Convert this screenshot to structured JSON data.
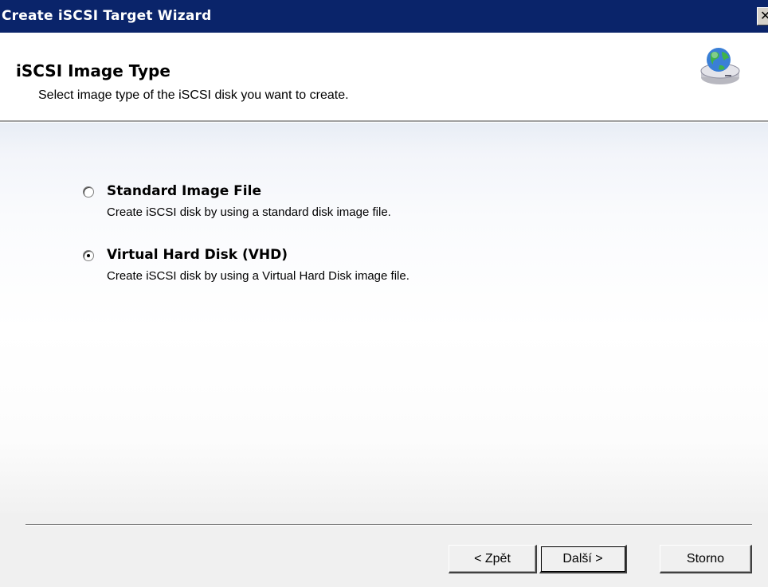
{
  "window": {
    "title": "Create iSCSI Target Wizard",
    "close_glyph": "✕"
  },
  "header": {
    "title": "iSCSI Image Type",
    "subtitle": "Select image type of the iSCSI disk you want to create.",
    "icon": "globe-disk-icon"
  },
  "options": [
    {
      "label": "Standard Image File",
      "description": "Create iSCSI disk by using a standard disk image file.",
      "selected": false
    },
    {
      "label": "Virtual Hard Disk (VHD)",
      "description": "Create iSCSI disk by using a Virtual Hard Disk image file.",
      "selected": true
    }
  ],
  "buttons": {
    "back": "< Zpět",
    "next": "Další >",
    "cancel": "Storno"
  },
  "colors": {
    "titlebar": "#0a246a",
    "face": "#f0f0f0"
  }
}
